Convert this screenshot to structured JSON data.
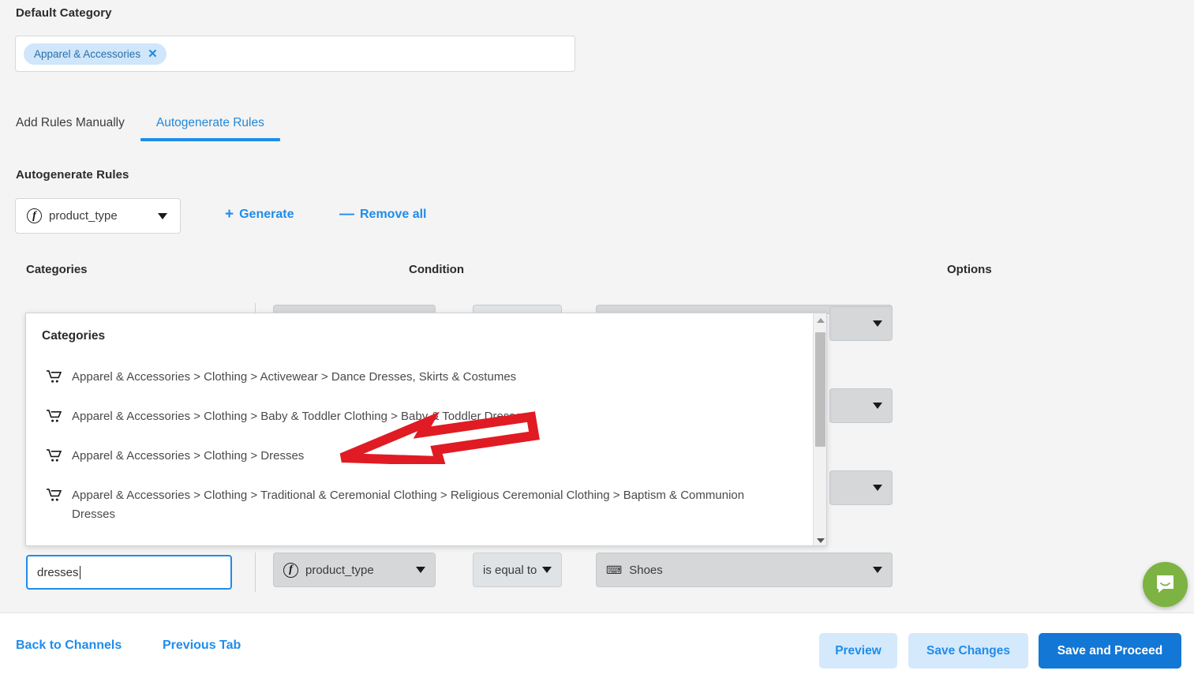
{
  "default_category": {
    "label": "Default Category",
    "chips": [
      {
        "text": "Apparel & Accessories",
        "remove": "✕"
      }
    ]
  },
  "tabs": [
    {
      "label": "Add Rules Manually",
      "active": false
    },
    {
      "label": "Autogenerate Rules",
      "active": true
    }
  ],
  "autogenerate": {
    "heading": "Autogenerate Rules",
    "field_select": {
      "value": "product_type",
      "icon": "fx-icon"
    },
    "generate_label": "Generate",
    "generate_sign": "+",
    "remove_all_label": "Remove all",
    "remove_all_sign": "—"
  },
  "columns": {
    "categories": "Categories",
    "condition": "Condition",
    "options": "Options"
  },
  "categories_panel": {
    "title": "Categories",
    "items": [
      {
        "icon": "cart-icon",
        "text": "Apparel & Accessories > Clothing > Activewear > Dance Dresses, Skirts & Costumes"
      },
      {
        "icon": "cart-icon",
        "text": "Apparel & Accessories > Clothing > Baby & Toddler Clothing > Baby & Toddler Dresses"
      },
      {
        "icon": "cart-icon",
        "text": "Apparel & Accessories > Clothing > Dresses"
      },
      {
        "icon": "cart-icon",
        "text": "Apparel & Accessories > Clothing > Traditional & Ceremonial Clothing > Religious Ceremonial Clothing > Baptism & Communion Dresses"
      }
    ]
  },
  "edit_row": {
    "category_input_value": "dresses",
    "field_select": {
      "value": "product_type",
      "icon": "fx-icon"
    },
    "operator_select": {
      "value": "is equal to"
    },
    "value_select": {
      "value": "Shoes",
      "icon": "keyboard-icon"
    }
  },
  "annotation": {
    "arrow_color": "#e01b24",
    "points_at": "Apparel & Accessories > Clothing > Dresses"
  },
  "footer": {
    "back_to_channels": "Back to Channels",
    "previous_tab": "Previous Tab",
    "preview": "Preview",
    "save_changes": "Save Changes",
    "save_and_proceed": "Save and Proceed"
  },
  "chat_widget": {
    "icon": "chat-bubble-icon",
    "color": "#7cb342"
  },
  "colors": {
    "accent_blue": "#1f8ceb",
    "primary_button": "#1377d6",
    "chip_bg": "#cfe6fb",
    "page_bg": "#f4f4f4",
    "select_grey": "#d5d7d9"
  }
}
